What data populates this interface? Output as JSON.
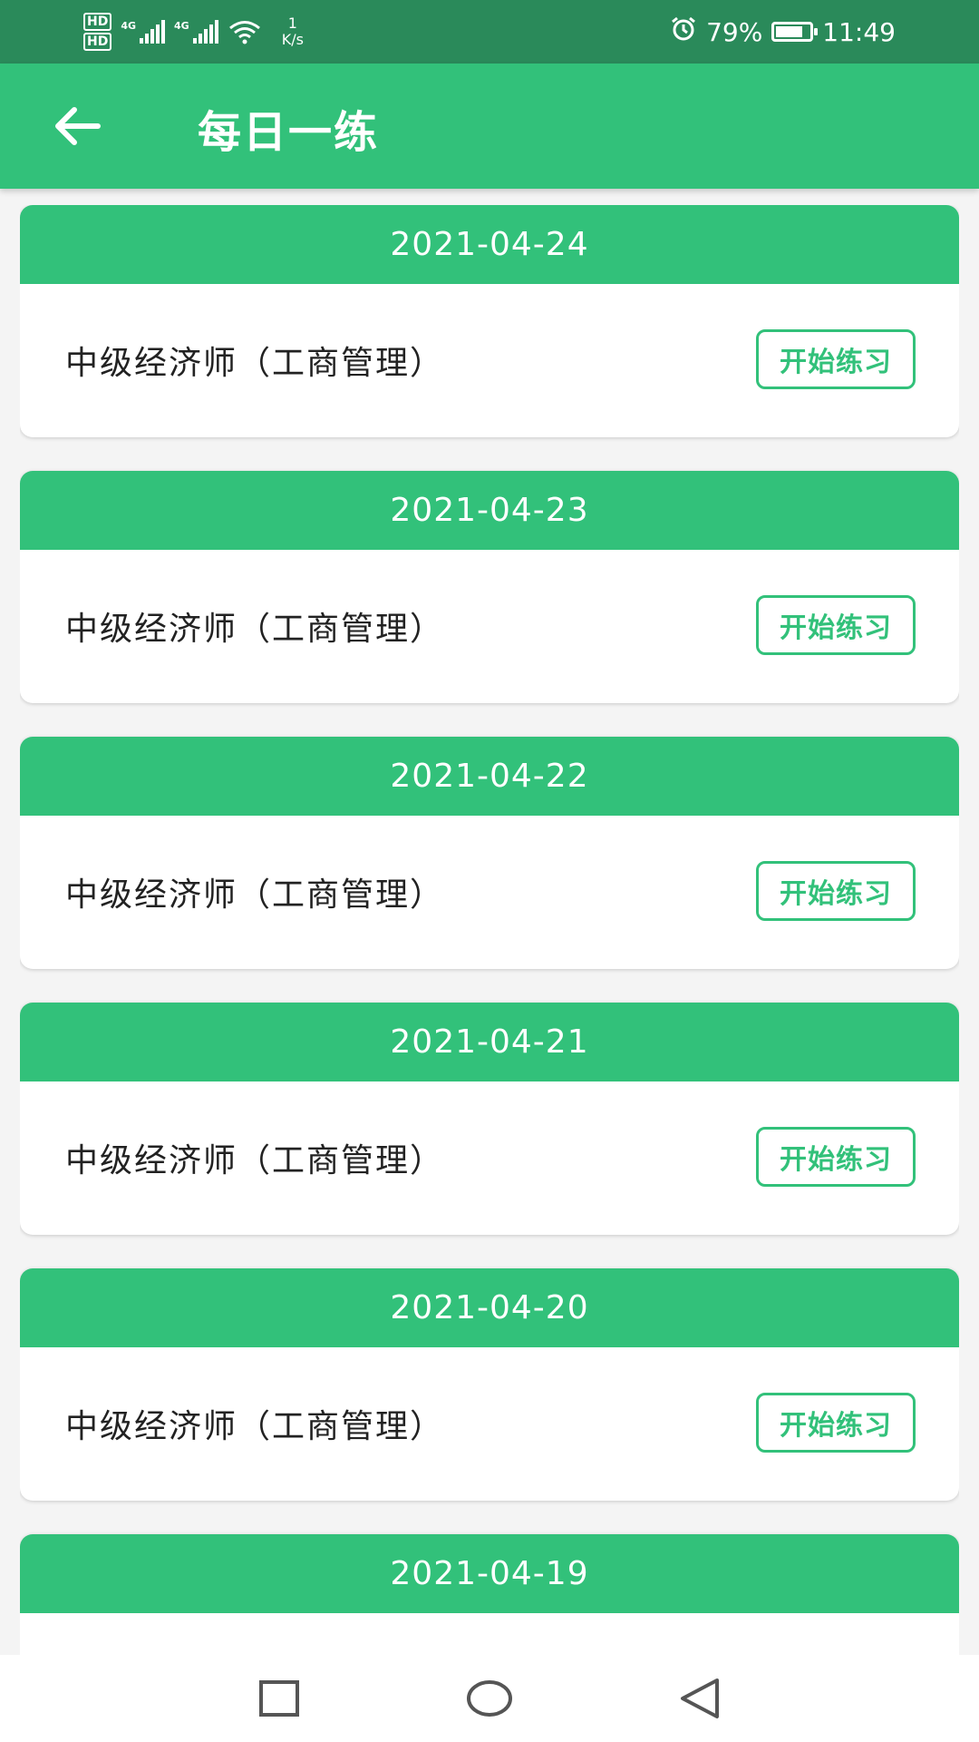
{
  "status_bar": {
    "sim1": "HD",
    "sim2": "HD",
    "net1": "4G",
    "net2": "4G",
    "speed_value": "1",
    "speed_unit": "K/s",
    "battery": "79%",
    "battery_level": 0.79,
    "time": "11:49"
  },
  "app_bar": {
    "title": "每日一练"
  },
  "list": {
    "items": [
      {
        "date": "2021-04-24",
        "subject": "中级经济师（工商管理）",
        "button": "开始练习"
      },
      {
        "date": "2021-04-23",
        "subject": "中级经济师（工商管理）",
        "button": "开始练习"
      },
      {
        "date": "2021-04-22",
        "subject": "中级经济师（工商管理）",
        "button": "开始练习"
      },
      {
        "date": "2021-04-21",
        "subject": "中级经济师（工商管理）",
        "button": "开始练习"
      },
      {
        "date": "2021-04-20",
        "subject": "中级经济师（工商管理）",
        "button": "开始练习"
      },
      {
        "date": "2021-04-19",
        "subject": "",
        "button": ""
      }
    ]
  },
  "colors": {
    "primary": "#32c17a",
    "status_bar": "#2a8a5a"
  }
}
